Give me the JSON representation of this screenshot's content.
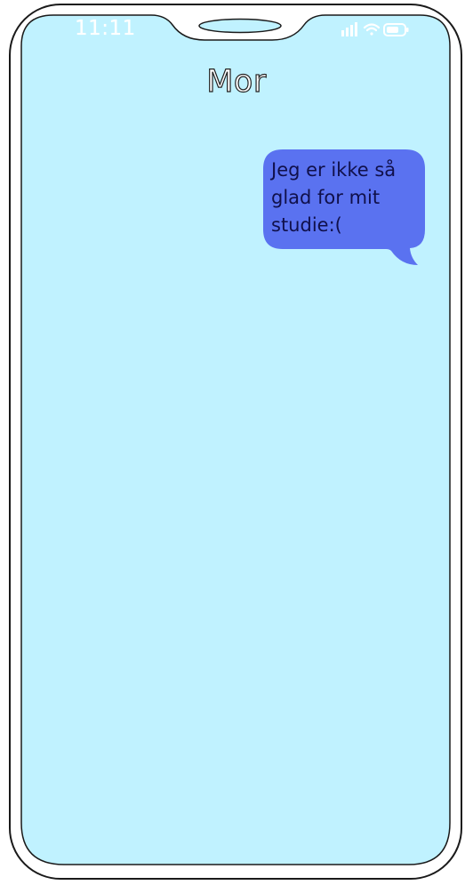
{
  "status_bar": {
    "time": "11:11",
    "signal_icon": "cellular-signal-icon",
    "wifi_icon": "wifi-icon",
    "battery_icon": "battery-icon"
  },
  "header": {
    "contact_name": "Mor"
  },
  "conversation": {
    "messages": [
      {
        "direction": "outgoing",
        "text": "Jeg er ikke så\nglad for mit\nstudie:("
      }
    ]
  },
  "colors": {
    "screen_background": "#c0f2ff",
    "bubble": "#5a72f0",
    "bubble_text": "#10104a",
    "notch_speaker": "#c0f2ff"
  }
}
